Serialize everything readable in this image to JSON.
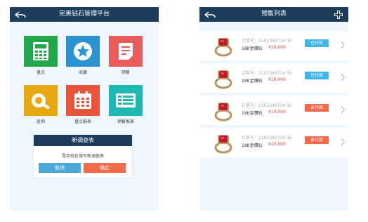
{
  "left": {
    "title": "完美钻石管理平台",
    "tiles": [
      {
        "label": "盘点",
        "color": "#22a84a"
      },
      {
        "label": "收藏",
        "color": "#2b93d1"
      },
      {
        "label": "预售",
        "color": "#e85b5b"
      },
      {
        "label": "查询",
        "color": "#e8a80f"
      },
      {
        "label": "盘点报表",
        "color": "#e8553a"
      },
      {
        "label": "销售报表",
        "color": "#20b8b5"
      }
    ],
    "dialog": {
      "title": "新调查表",
      "message": "是否现在填写新调查表",
      "cancel": "取消",
      "confirm": "确定"
    }
  },
  "right": {
    "title": "预售列表",
    "items": [
      {
        "order": "订单号：2102349734 5b",
        "material": "18K金镶钻",
        "price": "¥10,000",
        "status": "已付款",
        "status_color": "#3fb6e8"
      },
      {
        "order": "订单号：2102349734 5b",
        "material": "18K金镶钻",
        "price": "¥10,000",
        "status": "已付款",
        "status_color": "#3fb6e8"
      },
      {
        "order": "订单号：2102349734 5b",
        "material": "18K金镶钻",
        "price": "¥10,000",
        "status": "未付款",
        "status_color": "#f26a4a"
      },
      {
        "order": "订单号：2102349734 5b",
        "material": "18K金镶钻",
        "price": "¥10,000",
        "status": "未付款",
        "status_color": "#f26a4a"
      }
    ]
  },
  "colors": {
    "topbar": "#1e3c5c",
    "cancel_btn": "#4aa8d8",
    "confirm_btn": "#f26a4a"
  }
}
